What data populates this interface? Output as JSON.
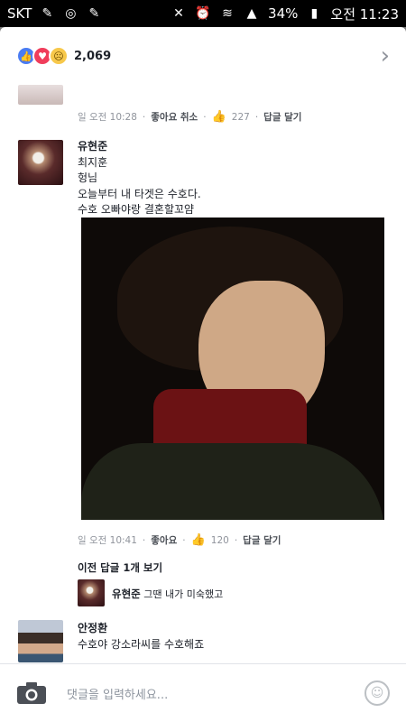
{
  "status": {
    "carrier": "SKT",
    "battery": "34%",
    "time": "오전 11:23"
  },
  "reactions": {
    "count": "2,069"
  },
  "comments": [
    {
      "meta": {
        "time": "일 오전 10:28",
        "like_action": "좋아요 취소",
        "likes": "227",
        "reply": "답글 달기"
      }
    },
    {
      "name": "유현준",
      "lines": [
        "최지훈",
        "헝님",
        "오늘부터 내 타겟은 수호다.",
        "수호 오빠야랑 결혼할꼬얌"
      ],
      "meta": {
        "time": "일 오전 10:41",
        "like_action": "좋아요",
        "likes": "120",
        "reply": "답글 달기"
      },
      "view_replies": "이전 답글 1개 보기",
      "reply": {
        "name": "유현준",
        "text": "그땐 내가 미숙했고"
      }
    },
    {
      "name": "안정환",
      "text": "수호야 강소라씨를 수호해죠"
    }
  ],
  "input": {
    "placeholder": "댓글을 입력하세요..."
  }
}
